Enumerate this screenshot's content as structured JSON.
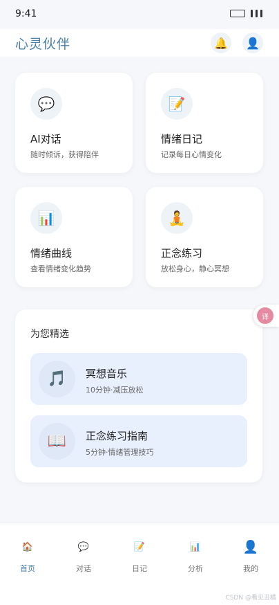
{
  "status_bar": {
    "time": "9:41"
  },
  "header": {
    "title": "心灵伙伴",
    "bell_icon": "bell-icon",
    "avatar_icon": "avatar-icon"
  },
  "features": [
    {
      "icon": "💬",
      "icon_name": "chat-icon",
      "title": "AI对话",
      "desc": "随时倾诉，获得陪伴"
    },
    {
      "icon": "📝",
      "icon_name": "diary-icon",
      "title": "情绪日记",
      "desc": "记录每日心情变化"
    },
    {
      "icon": "📊",
      "icon_name": "chart-icon",
      "title": "情绪曲线",
      "desc": "查看情绪变化趋势"
    },
    {
      "icon": "🧘",
      "icon_name": "meditation-icon",
      "title": "正念练习",
      "desc": "放松身心，静心冥想"
    }
  ],
  "recommendations": {
    "title": "为您精选",
    "items": [
      {
        "icon": "🎵",
        "icon_name": "music-icon",
        "title": "冥想音乐",
        "sub": "10分钟·减压放松"
      },
      {
        "icon": "📖",
        "icon_name": "book-icon",
        "title": "正念练习指南",
        "sub": "5分钟·情绪管理技巧"
      }
    ]
  },
  "translate_button": {
    "label": "译"
  },
  "bottom_nav": [
    {
      "icon": "🏠",
      "icon_name": "home-icon",
      "label": "首页",
      "active": true
    },
    {
      "icon": "💬",
      "icon_name": "chat-icon",
      "label": "对话",
      "active": false
    },
    {
      "icon": "📝",
      "icon_name": "diary-icon",
      "label": "日记",
      "active": false
    },
    {
      "icon": "📊",
      "icon_name": "analysis-icon",
      "label": "分析",
      "active": false
    },
    {
      "icon": "👤",
      "icon_name": "profile-icon",
      "label": "我的",
      "active": false
    }
  ],
  "watermark": "CSDN @看见丑橘",
  "colors": {
    "accent": "#4a7fa8",
    "background": "#f5f7fa",
    "rec_background": "#e9f0fd"
  }
}
